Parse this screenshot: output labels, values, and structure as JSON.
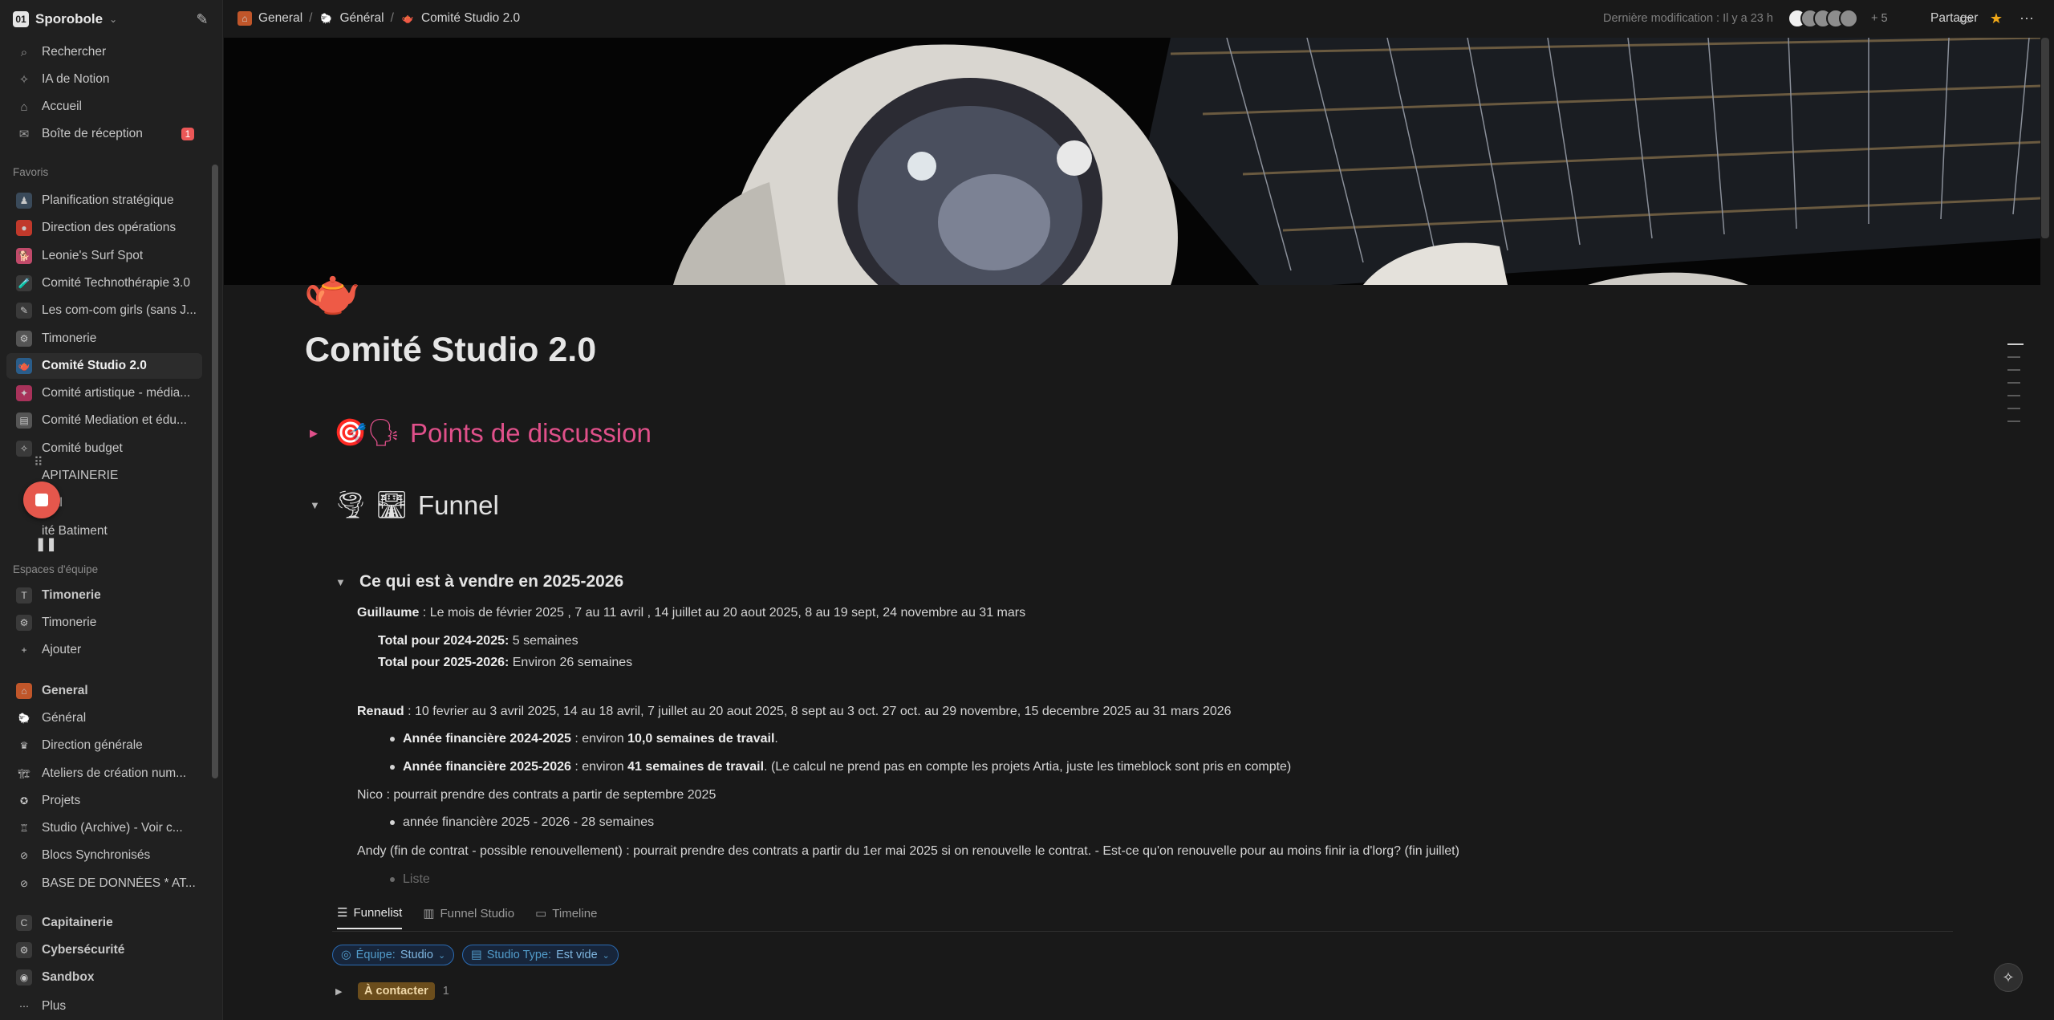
{
  "workspace": {
    "name": "Sporobole",
    "logo": "01"
  },
  "sidebar": {
    "top_items": [
      {
        "label": "Rechercher",
        "icon": "search-icon",
        "glyph": "⌕"
      },
      {
        "label": "IA de Notion",
        "icon": "notion-ai-icon",
        "glyph": "✧"
      },
      {
        "label": "Accueil",
        "icon": "home-icon",
        "glyph": "⌂"
      },
      {
        "label": "Boîte de réception",
        "icon": "inbox-icon",
        "glyph": "✉",
        "badge": "1"
      }
    ],
    "favorites_label": "Favoris",
    "favorites": [
      {
        "label": "Planification stratégique",
        "glyph": "♟",
        "color": "#3a4a5a"
      },
      {
        "label": "Direction des opérations",
        "glyph": "●",
        "color": "#c0392b"
      },
      {
        "label": "Leonie's Surf Spot",
        "glyph": "🐕",
        "color": "#c04a6a"
      },
      {
        "label": "Comité Technothérapie 3.0",
        "glyph": "🧪",
        "color": "#3a3a3a"
      },
      {
        "label": "Les com-com girls (sans J...",
        "glyph": "✎",
        "color": "#3a3a3a"
      },
      {
        "label": "Timonerie",
        "glyph": "⚙",
        "color": "#555555"
      },
      {
        "label": "Comité Studio 2.0",
        "glyph": "🫖",
        "color": "#2a5d8a",
        "active": true
      },
      {
        "label": "Comité artistique - média...",
        "glyph": "✦",
        "color": "#a8325a"
      },
      {
        "label": "Comité Mediation et édu...",
        "glyph": "▤",
        "color": "#555555"
      },
      {
        "label": "Comité budget",
        "glyph": "✧",
        "color": "#3a3a3a"
      },
      {
        "label": "APITAINERIE",
        "glyph": "",
        "color": "transparent"
      },
      {
        "label": "éral",
        "glyph": "",
        "color": "transparent"
      },
      {
        "label": "ité Batiment",
        "glyph": "",
        "color": "transparent"
      }
    ],
    "team_label": "Espaces d'équipe",
    "team": [
      {
        "label": "Timonerie",
        "glyph": "T",
        "color": "#3a3a3a",
        "bold": true
      },
      {
        "label": "Timonerie",
        "glyph": "⚙",
        "color": "#3a3a3a"
      },
      {
        "label": "Ajouter",
        "glyph": "+",
        "color": "transparent"
      }
    ],
    "general": [
      {
        "label": "General",
        "glyph": "⌂",
        "color": "#c0562a",
        "bold": true
      },
      {
        "label": "Général",
        "glyph": "🐑",
        "color": "transparent"
      },
      {
        "label": "Direction générale",
        "glyph": "♛",
        "color": "transparent"
      },
      {
        "label": "Ateliers de création num...",
        "glyph": "🏗",
        "color": "transparent"
      },
      {
        "label": "Projets",
        "glyph": "✪",
        "color": "transparent"
      },
      {
        "label": "Studio (Archive) - Voir c...",
        "glyph": "♖",
        "color": "transparent"
      },
      {
        "label": "Blocs Synchronisés",
        "glyph": "⊘",
        "color": "transparent"
      },
      {
        "label": "BASE DE DONNÉES * AT...",
        "glyph": "⊘",
        "color": "transparent"
      },
      {
        "label": "Capitainerie",
        "glyph": "C",
        "color": "#3a3a3a",
        "bold": true
      },
      {
        "label": "Cybersécurité",
        "glyph": "⚙",
        "color": "#3a3a3a",
        "bold": true
      },
      {
        "label": "Sandbox",
        "glyph": "◉",
        "color": "#3a3a3a",
        "bold": true
      },
      {
        "label": "Plus",
        "glyph": "⋯",
        "color": "transparent"
      }
    ]
  },
  "breadcrumb": [
    {
      "label": "General",
      "glyph": "⌂",
      "color": "#c0562a"
    },
    {
      "label": "Général",
      "glyph": "🐑",
      "color": "transparent"
    },
    {
      "label": "Comité Studio 2.0",
      "glyph": "🫖",
      "color": "transparent"
    }
  ],
  "topbar": {
    "last_modified": "Dernière modification : Il y a 23 h",
    "plus_count": "+ 5",
    "share": "Partager"
  },
  "page": {
    "icon": "🫖",
    "title": "Comité Studio 2.0",
    "sections": {
      "discussion": {
        "emoji": "🎯🗣",
        "title": "Points de discussion"
      },
      "funnel": {
        "emoji": "🌪 🛣",
        "title": "Funnel"
      },
      "sub_heading": "Ce qui est à vendre en 2025-2026"
    },
    "lines": {
      "guillaume_name": "Guillaume",
      "guillaume_text": " : Le mois de février 2025 , 7 au 11 avril , 14 juillet au 20 aout 2025, 8 au 19 sept, 24 novembre au 31 mars",
      "total_2425_label": "Total pour 2024-2025:",
      "total_2425_value": " 5 semaines",
      "total_2526_label": "Total pour 2025-2026:",
      "total_2526_value": " Environ 26 semaines",
      "renaud_name": "Renaud",
      "renaud_text": " : 10 fevrier au 3 avril 2025, 14 au 18 avril, 7 juillet au 20 aout 2025, 8 sept au 3 oct. 27 oct. au 29 novembre, 15 decembre 2025 au 31 mars 2026",
      "r_b1_label": "Année financière 2024-2025",
      "r_b1_mid": " : environ ",
      "r_b1_bold": "10,0 semaines de travail",
      "r_b1_end": ".",
      "r_b2_label": "Année financière 2025-2026",
      "r_b2_mid": " : environ ",
      "r_b2_bold": "41 semaines de travail",
      "r_b2_end": ". (Le calcul ne prend pas en compte les projets Artia, juste les timeblock sont pris en compte)",
      "nico": "Nico : pourrait prendre des contrats a partir de septembre  2025",
      "nico_b1": "année financière 2025 - 2026 - 28 semaines",
      "andy": "Andy (fin de contrat - possible renouvellement) : pourrait prendre des contrats a partir du 1er mai 2025 si on renouvelle le contrat. - Est-ce qu'on renouvelle pour au moins finir ia d'lorg? (fin juillet)",
      "list_placeholder": "Liste"
    }
  },
  "database": {
    "tabs": [
      {
        "label": "Funnelist",
        "glyph": "☰",
        "active": true
      },
      {
        "label": "Funnel Studio",
        "glyph": "▥"
      },
      {
        "label": "Timeline",
        "glyph": "▭"
      }
    ],
    "filters": [
      {
        "key": "Équipe:",
        "value": "Studio",
        "glyph": "◎"
      },
      {
        "key": "Studio Type:",
        "value": "Est vide",
        "glyph": "▤"
      }
    ],
    "group": {
      "label": "À contacter",
      "count": "1"
    }
  },
  "colors": {
    "accent_pink": "#e0508a",
    "filter_blue": "#529cca",
    "badge_red": "#eb5757"
  }
}
